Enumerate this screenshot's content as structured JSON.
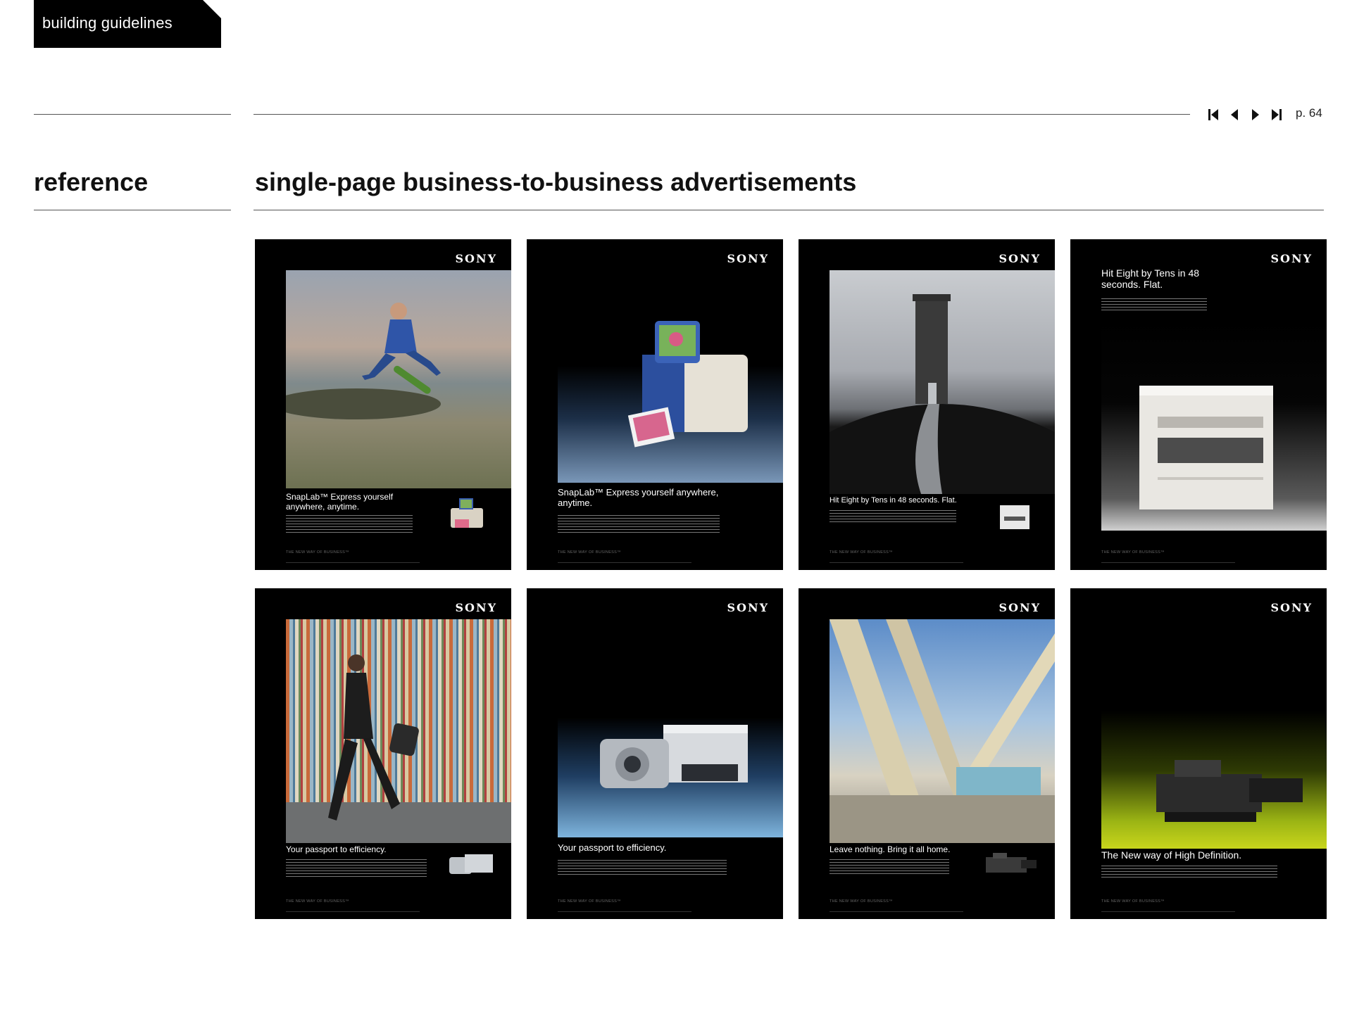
{
  "header": {
    "tab_label": "building guidelines"
  },
  "navigation": {
    "first_label": "first page",
    "prev_label": "previous page",
    "next_label": "next page",
    "last_label": "last page",
    "page": "p. 64"
  },
  "section": {
    "label": "reference"
  },
  "title": "single-page business-to-business advertisements",
  "ads": [
    {
      "brand": "SONY",
      "headline": "SnapLab™ Express yourself anywhere, anytime.",
      "tagline": "THE NEW WAY OF BUSINESS™"
    },
    {
      "brand": "SONY",
      "headline": "SnapLab™ Express yourself anywhere, anytime.",
      "tagline": "THE NEW WAY OF BUSINESS™"
    },
    {
      "brand": "SONY",
      "headline": "Hit Eight by Tens in 48 seconds. Flat.",
      "tagline": "THE NEW WAY OF BUSINESS™"
    },
    {
      "brand": "SONY",
      "headline": "Hit Eight by Tens in 48 seconds. Flat.",
      "tagline": "THE NEW WAY OF BUSINESS™"
    },
    {
      "brand": "SONY",
      "headline": "Your passport to efficiency.",
      "tagline": "THE NEW WAY OF BUSINESS™"
    },
    {
      "brand": "SONY",
      "headline": "Your passport to efficiency.",
      "tagline": "THE NEW WAY OF BUSINESS™"
    },
    {
      "brand": "SONY",
      "headline": "Leave nothing. Bring it all home.",
      "tagline": "THE NEW WAY OF BUSINESS™"
    },
    {
      "brand": "SONY",
      "headline": "The New way of High Definition.",
      "tagline": "THE NEW WAY OF BUSINESS™"
    }
  ]
}
